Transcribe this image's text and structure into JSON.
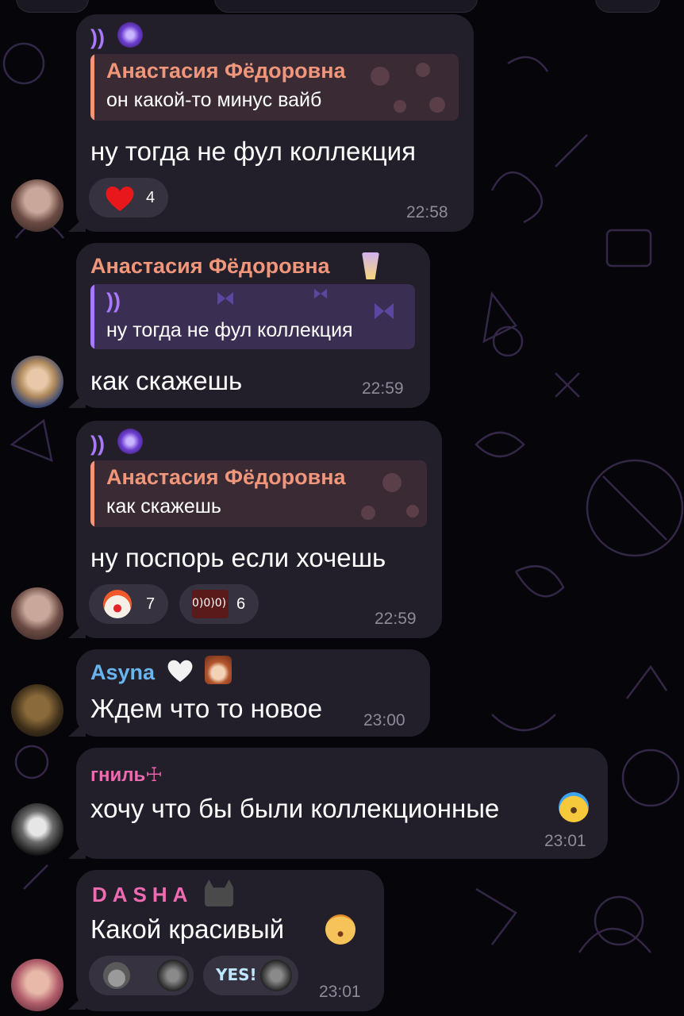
{
  "messages": [
    {
      "reply_to_text": "))",
      "quote_author": "Анастасия Фёдоровна",
      "quote_text": "он какой-то минус вайб",
      "text": "ну тогда не фул коллекция",
      "reactions": [
        {
          "emoji": "heart",
          "count": "4"
        }
      ],
      "time": "22:58"
    },
    {
      "sender": "Анастасия Фёдоровна",
      "quote_author": "))",
      "quote_text": "ну тогда не фул коллекция",
      "text": "как скажешь",
      "time": "22:59"
    },
    {
      "reply_to_text": "))",
      "quote_author": "Анастасия Фёдоровна",
      "quote_text": "как скажешь",
      "text": "ну поспорь если хочешь",
      "reactions": [
        {
          "emoji": "clown",
          "count": "7"
        },
        {
          "emoji": "0)0)0)",
          "count": "6"
        }
      ],
      "time": "22:59"
    },
    {
      "sender": "Asyna",
      "text": "Ждем что то новое",
      "time": "23:00"
    },
    {
      "sender": "гниль☩",
      "text": "хочу что бы были коллекционные",
      "time": "23:01"
    },
    {
      "sender": "DASHA",
      "text": "Какой красивый",
      "reactions": [
        {
          "emoji": "bear"
        },
        {
          "emoji": "YES!"
        }
      ],
      "time": "23:01"
    }
  ],
  "colors": {
    "background": "#06050a",
    "bubble": "#221f2b",
    "name_orange": "#f0967a",
    "name_blue": "#68b4ee",
    "name_pink": "#ee6bb1",
    "quote_violet": "#a878ff",
    "time": "#8e8a98"
  }
}
